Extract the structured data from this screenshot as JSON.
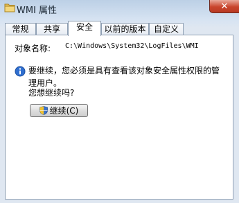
{
  "window": {
    "title": "WMI 属性",
    "close_glyph": "✕"
  },
  "tabs": [
    {
      "label": "常规",
      "active": false
    },
    {
      "label": "共享",
      "active": false
    },
    {
      "label": "安全",
      "active": true
    },
    {
      "label": "以前的版本",
      "active": false
    },
    {
      "label": "自定义",
      "active": false
    }
  ],
  "security": {
    "object_name_label": "对象名称:",
    "object_name_value": "C:\\Windows\\System32\\LogFiles\\WMI",
    "message": "要继续，您必须是具有查看该对象安全属性权限的管理用户。",
    "question": "您想继续吗?",
    "continue_button": "继续(C)"
  },
  "icons": {
    "title": "folder-icon",
    "info": "info-icon",
    "button": "uac-shield-icon"
  }
}
